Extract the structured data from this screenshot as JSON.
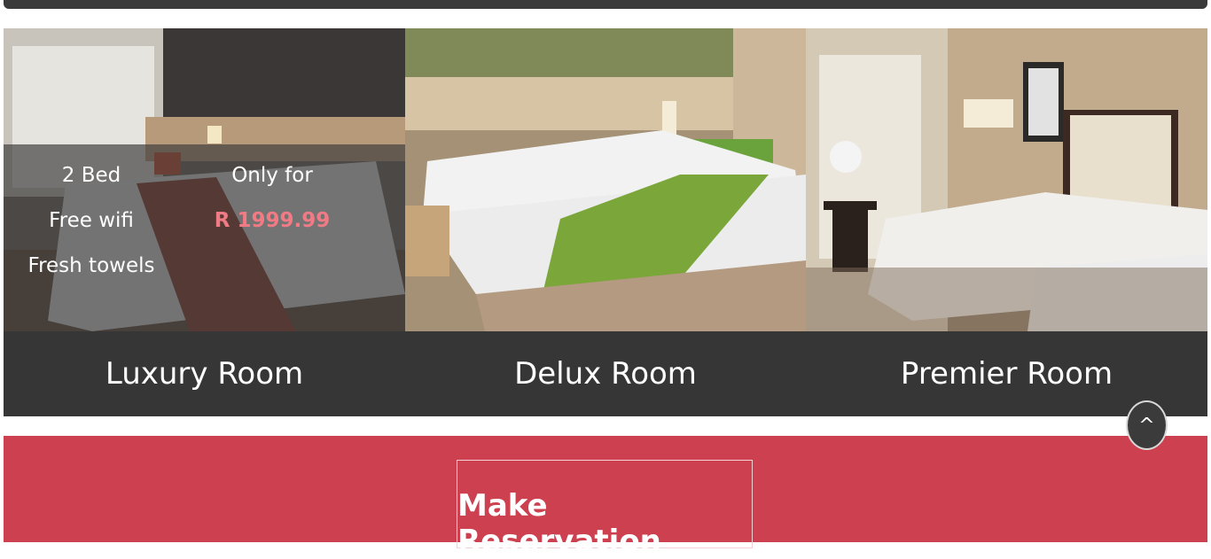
{
  "rooms": [
    {
      "title": "Luxury Room"
    },
    {
      "title": "Delux Room"
    },
    {
      "title": "Premier Room"
    }
  ],
  "luxury_overlay": {
    "features": [
      "2 Bed",
      "Free wifi",
      "Fresh towels"
    ],
    "price_label": "Only for",
    "price": "R 1999.99"
  },
  "reservation": {
    "button_label": "Make Reservation"
  },
  "scroll_top": {
    "label": "^"
  },
  "colors": {
    "title_bar": "#363636",
    "reservation_band": "#cc4050",
    "price": "#f07b84"
  }
}
